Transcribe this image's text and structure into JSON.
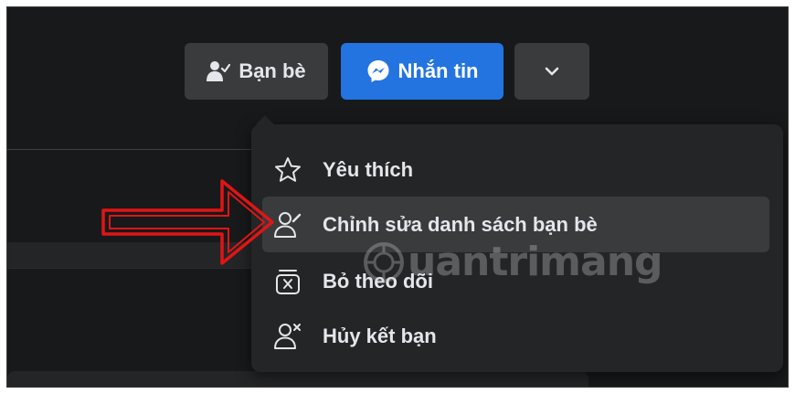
{
  "header": {
    "friends_button": {
      "label": "Bạn bè",
      "icon": "person-check-icon"
    },
    "message_button": {
      "label": "Nhắn tin",
      "icon": "messenger-icon"
    },
    "more_button": {
      "icon": "chevron-down-icon"
    }
  },
  "menu": {
    "items": [
      {
        "label": "Yêu thích",
        "icon": "star-icon"
      },
      {
        "label": "Chỉnh sửa danh sách bạn bè",
        "icon": "person-edit-icon"
      },
      {
        "label": "Bỏ theo dõi",
        "icon": "unfollow-box-icon"
      },
      {
        "label": "Hủy kết bạn",
        "icon": "person-remove-icon"
      }
    ]
  },
  "watermark": {
    "text": "uantrimang"
  },
  "colors": {
    "background": "#18191a",
    "surface": "#242526",
    "button": "#3a3b3c",
    "accent": "#2374e1",
    "text": "#e4e6eb",
    "annotation_arrow": "#e01515"
  }
}
